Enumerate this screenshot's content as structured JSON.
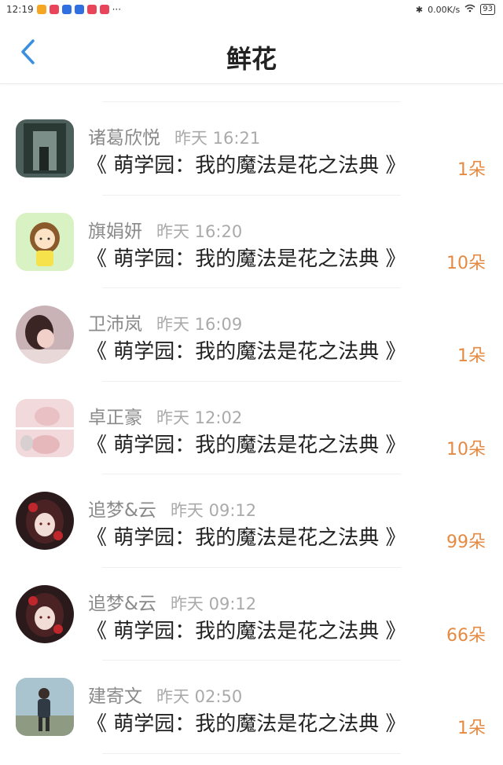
{
  "status_bar": {
    "time": "12:19",
    "more": "···",
    "network_speed": "0.00K/s",
    "battery": "93",
    "app_icon_colors": [
      "#f5a623",
      "#e8455b",
      "#2f6fe0",
      "#2f6fe0",
      "#e8455b",
      "#e8455b"
    ]
  },
  "header": {
    "title": "鲜花",
    "back_icon": "chevron-left-icon",
    "accent_color": "#3b8fe0"
  },
  "records": [
    {
      "name": "诸葛欣悦",
      "time": "昨天 16:21",
      "book": "《 萌学园：我的魔法是花之法典 》",
      "amount": "1朵",
      "avatar": "dark-alley-photo"
    },
    {
      "name": "旗娟妍",
      "time": "昨天 16:20",
      "book": "《 萌学园：我的魔法是花之法典 》",
      "amount": "10朵",
      "avatar": "cartoon-girl"
    },
    {
      "name": "卫沛岚",
      "time": "昨天 16:09",
      "book": "《 萌学园：我的魔法是花之法典 》",
      "amount": "1朵",
      "avatar": "girl-portrait"
    },
    {
      "name": "卓正豪",
      "time": "昨天 12:02",
      "book": "《 萌学园：我的魔法是花之法典 》",
      "amount": "10朵",
      "avatar": "pink-portrait"
    },
    {
      "name": "追梦&云",
      "time": "昨天 09:12",
      "book": "《 萌学园：我的魔法是花之法典 》",
      "amount": "99朵",
      "avatar": "anime-girl"
    },
    {
      "name": "追梦&云",
      "time": "昨天 09:12",
      "book": "《 萌学园：我的魔法是花之法典 》",
      "amount": "66朵",
      "avatar": "anime-girl"
    },
    {
      "name": "建寄文",
      "time": "昨天 02:50",
      "book": "《 萌学园：我的魔法是花之法典 》",
      "amount": "1朵",
      "avatar": "boy-walking-photo"
    }
  ]
}
